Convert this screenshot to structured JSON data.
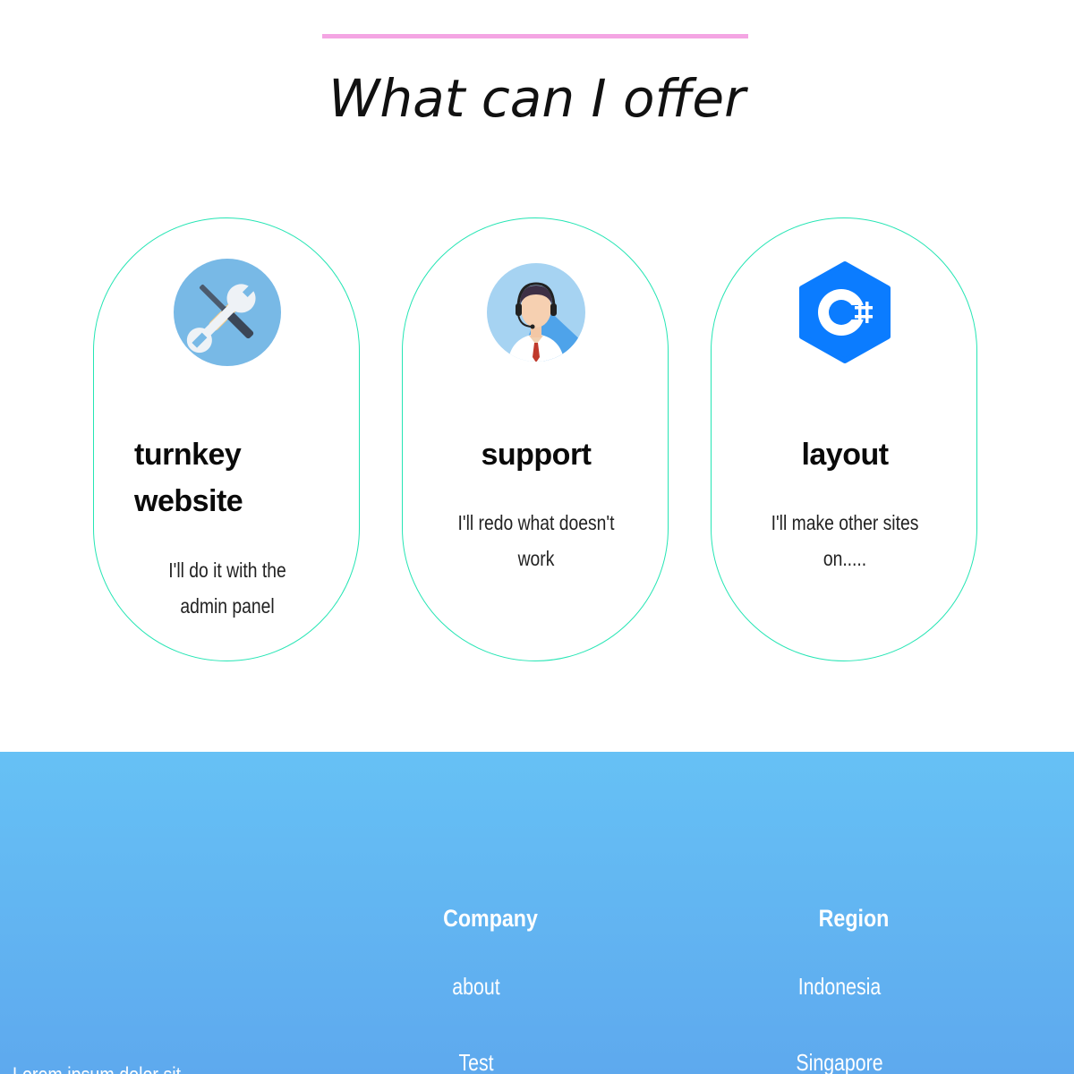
{
  "offer": {
    "title": "What can I offer",
    "accent_color": "#f4a5e3",
    "card_border_color": "#25e5b4",
    "cards": [
      {
        "icon": "tools-icon",
        "heading": "turnkey website",
        "text": "I'll do it with the admin panel"
      },
      {
        "icon": "support-agent-icon",
        "heading": "support",
        "text": "I'll redo what doesn't work"
      },
      {
        "icon": "csharp-icon",
        "heading": "layout",
        "text": "I'll make other sites on....."
      }
    ]
  },
  "footer": {
    "background_top": "#66c1f5",
    "background_bottom": "#5ea9ee",
    "cut_off_text": "Lorem ipsum dolor sit",
    "company": {
      "heading": "Company",
      "links": [
        "about",
        "Test"
      ]
    },
    "region": {
      "heading": "Region",
      "links": [
        "Indonesia",
        "Singapore"
      ]
    }
  }
}
